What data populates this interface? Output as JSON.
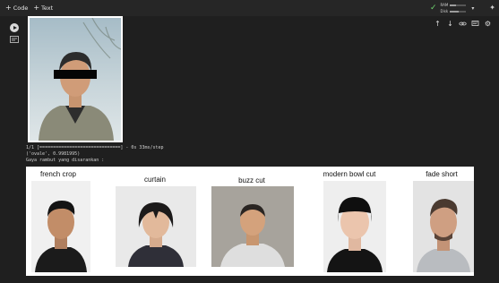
{
  "toolbar": {
    "code_label": "Code",
    "text_label": "Text"
  },
  "runtime": {
    "ram_label": "RAM",
    "disk_label": "Disk",
    "ram_level": 0.35,
    "disk_level": 0.55
  },
  "colors": {
    "background": "#1f1f1f",
    "check": "#6fd66f",
    "results_bg": "#ffffff"
  },
  "log": {
    "progress_line": "1/1 [==============================] - 0s 33ms/step",
    "prediction_line": "('ovale', 0.9981995)",
    "recommend_line": "Gaya rambut yang disarankan :"
  },
  "hairstyles": [
    {
      "label": "french crop"
    },
    {
      "label": "curtain"
    },
    {
      "label": "buzz cut"
    },
    {
      "label": "modern bowl cut"
    },
    {
      "label": "fade short"
    }
  ]
}
